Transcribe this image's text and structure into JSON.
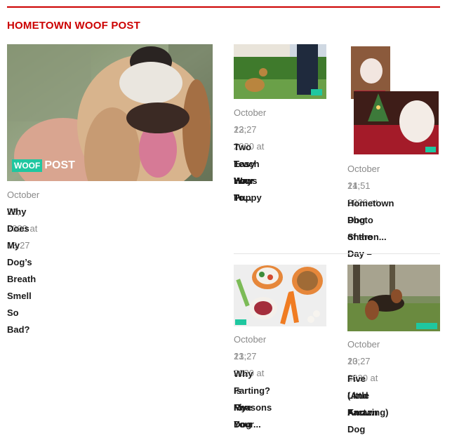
{
  "section": {
    "title": "HOMETOWN WOOF POST"
  },
  "logo": {
    "woof": "WOOF",
    "post": "POST"
  },
  "articles": [
    {
      "date": "October 23, 2020 at 13:27",
      "title": "Why Does My Dog’s Breath Smell So Bad?"
    },
    {
      "date_line1": "October 22, 2020 at",
      "date_line2": "13:27",
      "title_line1": "Two Easy Ways To",
      "title_line2": "Teach Your Puppy",
      "title_line3": "How To..."
    },
    {
      "date_line1": "October 21, 2020 at",
      "date_line2": "14:51",
      "title_line1": "Hometown Dog",
      "title_line2": "Photo of the Day –",
      "title_line3": "Sharon..."
    },
    {
      "date_line1": "October 21, 2020 at",
      "date_line2": "13:27",
      "title_line1": "Why Is My Dog",
      "title_line2": "Farting? Five",
      "title_line3": "Reasons Your..."
    },
    {
      "date_line1": "October 20, 2020 at",
      "date_line2": "13:27",
      "title_line1": "Five Little Known",
      "title_line2": "(And Amazing) Dog",
      "title_line3": "Fact..."
    }
  ]
}
